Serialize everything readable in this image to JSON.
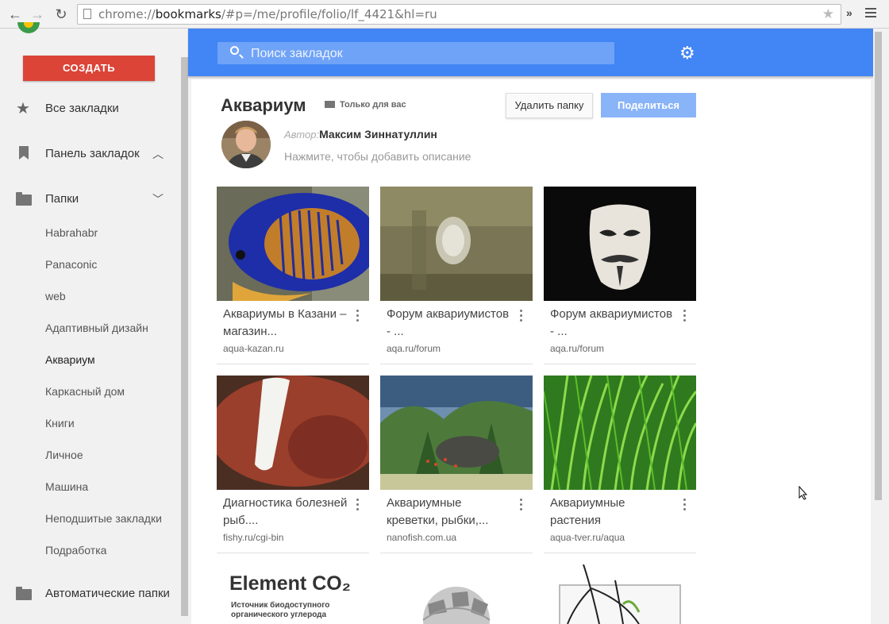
{
  "browser": {
    "url_scheme": "chrome://",
    "url_host": "bookmarks",
    "url_path": "/#p=/me/profile/folio/lf_4421&hl=ru",
    "ext_label": "»"
  },
  "sidebar": {
    "create_label": "СОЗДАТЬ",
    "all_bookmarks": "Все закладки",
    "bookmarks_bar": "Панель закладок",
    "folders": "Папки",
    "folder_items": [
      "Habrahabr",
      "Panaconic",
      "web",
      "Адаптивный дизайн",
      "Аквариум",
      "Каркасный дом",
      "Книги",
      "Личное",
      "Машина",
      "Неподшитые закладки",
      "Подработка"
    ],
    "auto_folders": "Автоматические папки"
  },
  "search": {
    "placeholder": "Поиск закладок"
  },
  "folder": {
    "title": "Аквариум",
    "visibility": "Только для вас",
    "delete_label": "Удалить папку",
    "share_label": "Поделиться",
    "author_prefix": "Автор:",
    "author_name": "Максим Зиннатуллин",
    "description_placeholder": "Нажмите, чтобы добавить описание"
  },
  "cards": [
    {
      "title": "Аквариумы в Казани – магазин...",
      "url": "aqua-kazan.ru"
    },
    {
      "title": "Форум аквариумистов - ...",
      "url": "aqa.ru/forum"
    },
    {
      "title": "Форум аквариумистов - ...",
      "url": "aqa.ru/forum"
    },
    {
      "title": "Диагностика болезней рыб....",
      "url": "fishy.ru/cgi-bin"
    },
    {
      "title": "Аквариумные креветки, рыбки,...",
      "url": "nanofish.com.ua"
    },
    {
      "title": "Аквариумные растения",
      "url": "aqua-tver.ru/aqua"
    }
  ],
  "partial_cards": {
    "logo_text": "Element CO₂",
    "logo_sub": "Источник биодоступного органического углерода"
  }
}
